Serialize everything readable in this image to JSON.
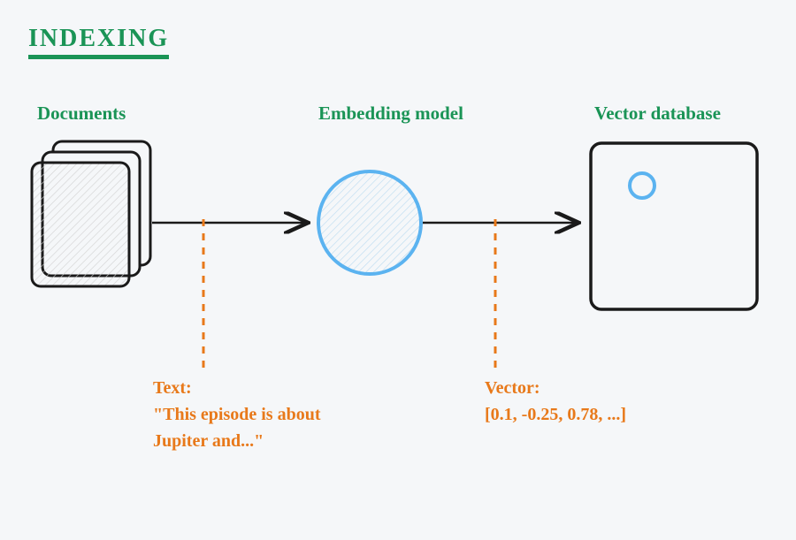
{
  "title": "INDEXING",
  "labels": {
    "documents": "Documents",
    "embedding": "Embedding model",
    "vectordb": "Vector database"
  },
  "annotations": {
    "text_label": "Text:",
    "text_value": "\"This episode is about Jupiter and...\"",
    "vector_label": "Vector:",
    "vector_value": "[0.1, -0.25, 0.78, ...]"
  },
  "colors": {
    "green": "#1a9456",
    "orange": "#e8791a",
    "blue": "#5bb3f0",
    "black": "#1a1a1a",
    "fill_hatch": "#e8e8e8",
    "bg": "#f5f7f9"
  }
}
